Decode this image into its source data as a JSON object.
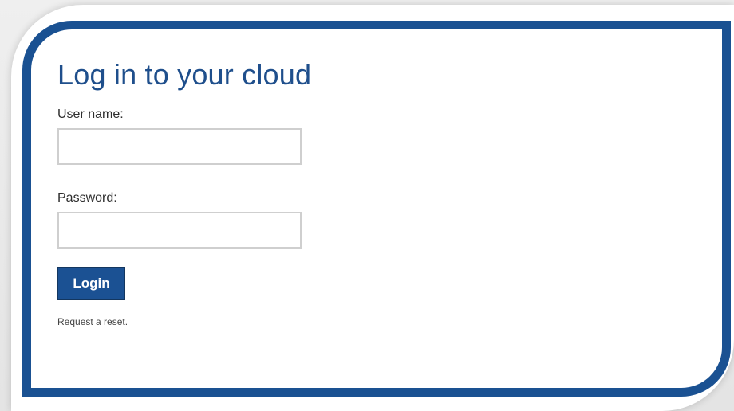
{
  "login": {
    "title": "Log in to your cloud",
    "username_label": "User name:",
    "username_value": "",
    "password_label": "Password:",
    "password_value": "",
    "login_button": "Login",
    "reset_link": "Request a reset."
  },
  "colors": {
    "accent": "#1a5192",
    "title": "#1f4f8c",
    "field_border": "#cfcfcf"
  }
}
